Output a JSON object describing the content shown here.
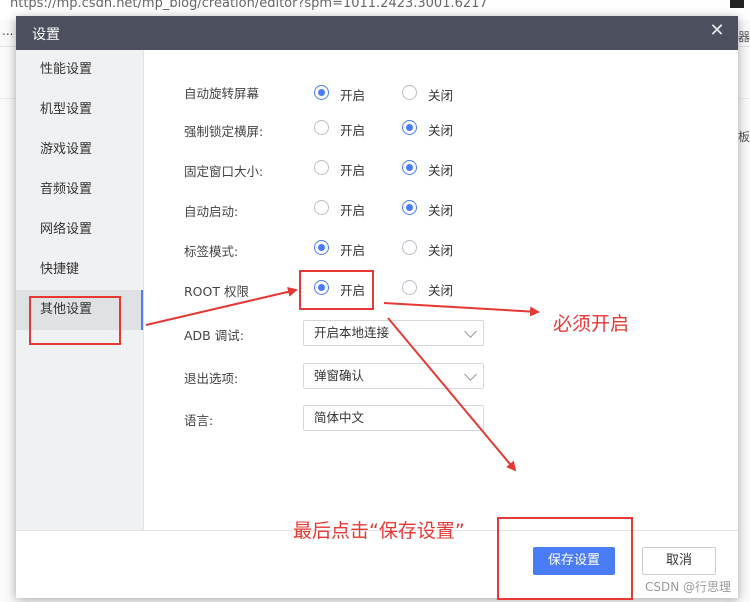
{
  "background": {
    "url_text": "https://mp.csdn.net/mp_blog/creation/editor?spm=1011.2423.3001.6217",
    "dots": "...",
    "right_fragments": [
      "器",
      "板"
    ]
  },
  "dialog": {
    "title": "设置",
    "close_glyph": "✕"
  },
  "sidebar": {
    "items": [
      {
        "label": "性能设置",
        "active": false
      },
      {
        "label": "机型设置",
        "active": false
      },
      {
        "label": "游戏设置",
        "active": false
      },
      {
        "label": "音频设置",
        "active": false
      },
      {
        "label": "网络设置",
        "active": false
      },
      {
        "label": "快捷键",
        "active": false
      },
      {
        "label": "其他设置",
        "active": true
      }
    ]
  },
  "settings": {
    "on_label": "开启",
    "off_label": "关闭",
    "radios": [
      {
        "label": "自动旋转屏幕",
        "value": "开启"
      },
      {
        "label": "强制锁定横屏:",
        "value": "关闭"
      },
      {
        "label": "固定窗口大小:",
        "value": "关闭"
      },
      {
        "label": "自动启动:",
        "value": "关闭"
      },
      {
        "label": "标签模式:",
        "value": "开启"
      },
      {
        "label": "ROOT 权限",
        "value": "开启"
      }
    ],
    "adb": {
      "label": "ADB 调试:",
      "value": "开启本地连接"
    },
    "exit": {
      "label": "退出选项:",
      "value": "弹窗确认"
    },
    "language": {
      "label": "语言:",
      "value": "简体中文"
    }
  },
  "footer": {
    "save_label": "保存设置",
    "cancel_label": "取消"
  },
  "annotations": {
    "must_enable": "必须开启",
    "finally_click": "最后点击“保存设置”"
  },
  "watermark": "CSDN @行思理",
  "colors": {
    "titlebar": "#4b4f5e",
    "accent": "#4a7cf7",
    "annotation": "#e53935"
  }
}
